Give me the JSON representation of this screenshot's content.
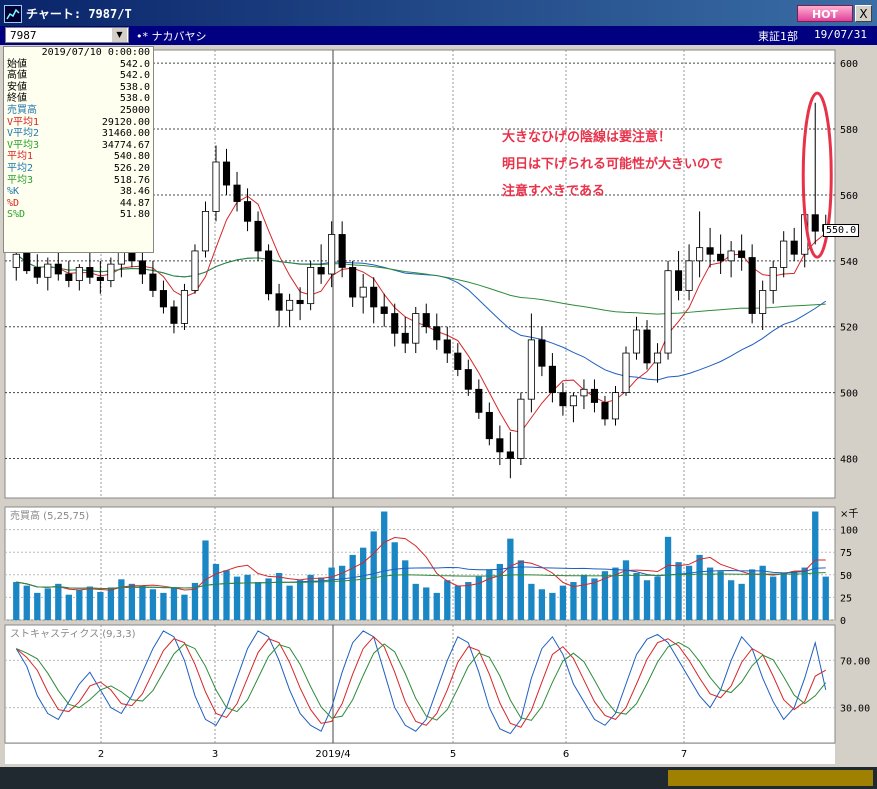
{
  "window": {
    "title": "チャート: 7987/T",
    "hot_label": "HOT",
    "close_label": "X"
  },
  "toolbar": {
    "code": "7987",
    "name": "•* ナカバヤシ",
    "market": "東証1部",
    "date": "19/07/31"
  },
  "info": {
    "datetime": "2019/07/10 0:00:00",
    "rows": [
      {
        "label": "始値",
        "value": "542.0",
        "color": "#000000"
      },
      {
        "label": "高値",
        "value": "542.0",
        "color": "#000000"
      },
      {
        "label": "安値",
        "value": "538.0",
        "color": "#000000"
      },
      {
        "label": "終値",
        "value": "538.0",
        "color": "#000000"
      },
      {
        "label": "売買高",
        "value": "25000",
        "color": "#1f77b4"
      },
      {
        "label": "V平均1",
        "value": "29120.00",
        "color": "#d62728"
      },
      {
        "label": "V平均2",
        "value": "31460.00",
        "color": "#1f77b4"
      },
      {
        "label": "V平均3",
        "value": "34774.67",
        "color": "#2ca02c"
      },
      {
        "label": "平均1",
        "value": "540.80",
        "color": "#d62728"
      },
      {
        "label": "平均2",
        "value": "526.20",
        "color": "#1f77b4"
      },
      {
        "label": "平均3",
        "value": "518.76",
        "color": "#2ca02c"
      },
      {
        "label": "%K",
        "value": "38.46",
        "color": "#1f77b4"
      },
      {
        "label": "%D",
        "value": "44.87",
        "color": "#d62728"
      },
      {
        "label": "S%D",
        "value": "51.80",
        "color": "#2ca02c"
      }
    ]
  },
  "annotation": {
    "lines": [
      "大きなひげの陰線は要注意！",
      "明日は下げられる可能性が大きいので",
      "注意すべきである"
    ],
    "color": "#e8324a"
  },
  "price_tag": "550.0",
  "panels": {
    "volume_title": "売買高 (5,25,75)",
    "volume_unit": "×千",
    "stoch_title": "ストキャスティクス (9,3,3)"
  },
  "colors": {
    "candle_up": "#ffffff",
    "candle_down": "#000000",
    "ma1": "#d62728",
    "ma2": "#1f5fbf",
    "ma3": "#2e8b3a",
    "volume_bar": "#1b86c4"
  },
  "chart_data": [
    {
      "type": "candlestick",
      "title": "",
      "y_ticks": [
        480,
        500,
        520,
        540,
        560,
        580,
        600
      ],
      "ylim": [
        468,
        604
      ],
      "x_tick_labels": [
        "2",
        "3",
        "2019/4",
        "5",
        "6",
        "7"
      ],
      "ohlc": [
        [
          538,
          544,
          534,
          542
        ],
        [
          543,
          547,
          536,
          537
        ],
        [
          538,
          542,
          533,
          535
        ],
        [
          535,
          541,
          531,
          539
        ],
        [
          539,
          545,
          534,
          536
        ],
        [
          536,
          540,
          532,
          534
        ],
        [
          534,
          539,
          531,
          538
        ],
        [
          538,
          543,
          533,
          535
        ],
        [
          535,
          540,
          530,
          534
        ],
        [
          534,
          541,
          532,
          539
        ],
        [
          539,
          545,
          535,
          543
        ],
        [
          543,
          548,
          538,
          540
        ],
        [
          540,
          544,
          533,
          536
        ],
        [
          536,
          540,
          529,
          531
        ],
        [
          531,
          534,
          524,
          526
        ],
        [
          526,
          528,
          518,
          521
        ],
        [
          521,
          533,
          519,
          531
        ],
        [
          531,
          545,
          530,
          543
        ],
        [
          543,
          558,
          541,
          555
        ],
        [
          555,
          575,
          552,
          570
        ],
        [
          570,
          574,
          560,
          563
        ],
        [
          563,
          567,
          555,
          558
        ],
        [
          558,
          562,
          549,
          552
        ],
        [
          552,
          555,
          540,
          543
        ],
        [
          543,
          545,
          528,
          530
        ],
        [
          530,
          533,
          520,
          525
        ],
        [
          525,
          530,
          520,
          528
        ],
        [
          528,
          532,
          522,
          527
        ],
        [
          527,
          540,
          525,
          538
        ],
        [
          538,
          545,
          533,
          536
        ],
        [
          536,
          552,
          532,
          548
        ],
        [
          548,
          552,
          535,
          538
        ],
        [
          538,
          540,
          526,
          529
        ],
        [
          529,
          536,
          524,
          532
        ],
        [
          532,
          535,
          521,
          526
        ],
        [
          526,
          530,
          520,
          524
        ],
        [
          524,
          527,
          514,
          518
        ],
        [
          518,
          523,
          512,
          515
        ],
        [
          515,
          526,
          512,
          524
        ],
        [
          524,
          527,
          518,
          520
        ],
        [
          520,
          524,
          513,
          516
        ],
        [
          516,
          520,
          509,
          512
        ],
        [
          512,
          515,
          505,
          507
        ],
        [
          507,
          510,
          499,
          501
        ],
        [
          501,
          504,
          492,
          494
        ],
        [
          494,
          497,
          484,
          486
        ],
        [
          486,
          490,
          478,
          482
        ],
        [
          482,
          488,
          474,
          480
        ],
        [
          480,
          500,
          478,
          498
        ],
        [
          498,
          524,
          494,
          516
        ],
        [
          516,
          520,
          505,
          508
        ],
        [
          508,
          512,
          497,
          500
        ],
        [
          500,
          503,
          493,
          496
        ],
        [
          496,
          500,
          491,
          499
        ],
        [
          499,
          504,
          495,
          501
        ],
        [
          501,
          504,
          494,
          497
        ],
        [
          497,
          499,
          490,
          492
        ],
        [
          492,
          502,
          490,
          500
        ],
        [
          500,
          514,
          499,
          512
        ],
        [
          512,
          523,
          510,
          519
        ],
        [
          519,
          522,
          507,
          509
        ],
        [
          509,
          515,
          503,
          512
        ],
        [
          512,
          540,
          510,
          537
        ],
        [
          537,
          543,
          528,
          531
        ],
        [
          531,
          545,
          528,
          540
        ],
        [
          540,
          555,
          535,
          544
        ],
        [
          544,
          550,
          538,
          542
        ],
        [
          542,
          548,
          536,
          540
        ],
        [
          540,
          546,
          535,
          543
        ],
        [
          543,
          548,
          537,
          541
        ],
        [
          541,
          545,
          521,
          524
        ],
        [
          524,
          534,
          519,
          531
        ],
        [
          531,
          540,
          527,
          538
        ],
        [
          538,
          549,
          535,
          546
        ],
        [
          546,
          550,
          540,
          542
        ],
        [
          542,
          556,
          538,
          554
        ],
        [
          554,
          588,
          545,
          549
        ],
        [
          549,
          554,
          546,
          551
        ]
      ],
      "volume": {
        "y_ticks": [
          0,
          25,
          50,
          75,
          100
        ],
        "ylim": [
          0,
          125
        ],
        "values": [
          42,
          38,
          30,
          35,
          40,
          28,
          33,
          37,
          31,
          36,
          45,
          40,
          38,
          34,
          30,
          36,
          28,
          41,
          88,
          62,
          55,
          48,
          50,
          42,
          46,
          52,
          38,
          44,
          50,
          47,
          58,
          60,
          72,
          80,
          98,
          120,
          86,
          66,
          40,
          36,
          30,
          44,
          38,
          42,
          48,
          56,
          62,
          90,
          66,
          40,
          34,
          30,
          38,
          42,
          50,
          46,
          54,
          58,
          66,
          52,
          44,
          48,
          92,
          64,
          60,
          72,
          58,
          54,
          44,
          40,
          56,
          60,
          48,
          52,
          54,
          58,
          120,
          48
        ]
      },
      "stochastic": {
        "y_ticks": [
          30,
          70
        ],
        "ylim": [
          0,
          100
        ],
        "k": [
          80,
          65,
          40,
          25,
          20,
          35,
          50,
          60,
          45,
          30,
          25,
          40,
          60,
          80,
          95,
          90,
          70,
          40,
          20,
          15,
          30,
          55,
          80,
          95,
          90,
          70,
          45,
          25,
          15,
          10,
          30,
          60,
          85,
          95,
          90,
          60,
          30,
          15,
          10,
          20,
          45,
          70,
          90,
          85,
          60,
          30,
          12,
          8,
          20,
          55,
          80,
          90,
          75,
          50,
          35,
          20,
          15,
          25,
          50,
          75,
          88,
          92,
          85,
          70,
          55,
          40,
          30,
          45,
          70,
          90,
          80,
          55,
          35,
          20,
          30,
          55,
          85,
          45
        ]
      }
    }
  ]
}
